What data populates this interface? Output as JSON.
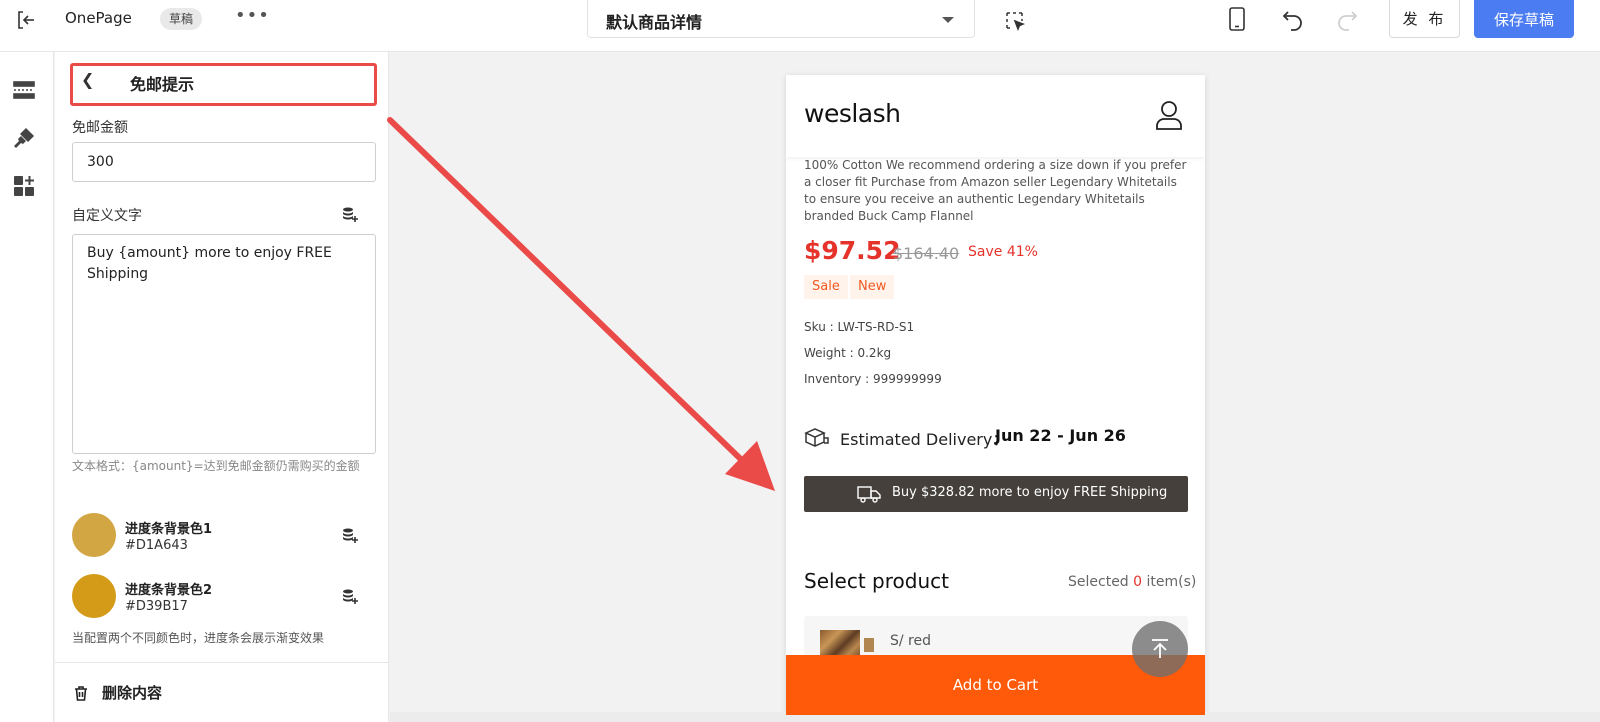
{
  "topbar": {
    "app_name": "OnePage",
    "status_badge": "草稿",
    "more": "•••",
    "template_select": "默认商品详情",
    "publish_label": "发 布",
    "save_label": "保存草稿"
  },
  "panel": {
    "back_title": "免邮提示",
    "amount_label": "免邮金额",
    "amount_value": "300",
    "text_label": "自定义文字",
    "text_value": "Buy {amount} more to enjoy FREE Shipping",
    "text_hint": "文本格式：{amount}=达到免邮金额仍需购买的金额",
    "colors": [
      {
        "title": "进度条背景色1",
        "hex": "#D1A643",
        "swatch": "#D1A643"
      },
      {
        "title": "进度条背景色2",
        "hex": "#D39B17",
        "swatch": "#D39B17"
      }
    ],
    "gradient_note": "当配置两个不同颜色时，进度条会展示渐变效果",
    "delete_label": "删除内容"
  },
  "preview": {
    "logo": "weslash",
    "description": "100% Cotton We recommend ordering a size down if you prefer a closer fit Purchase from Amazon seller Legendary Whitetails to ensure you receive an authentic Legendary Whitetails branded Buck Camp Flannel",
    "price": "$97.52",
    "old_price": "$164.40",
    "save": "Save 41%",
    "tags": [
      "Sale",
      "New"
    ],
    "sku": "Sku : LW-TS-RD-S1",
    "weight": "Weight : 0.2kg",
    "inventory": "Inventory : 999999999",
    "delivery_label": "Estimated Delivery：",
    "delivery_date": "Jun 22 - Jun 26",
    "shipping_bar": "Buy $328.82 more to enjoy FREE Shipping",
    "select_title": "Select product",
    "selected_prefix": "Selected",
    "selected_count": "0",
    "selected_suffix": "item(s)",
    "variant": "S/ red",
    "cart_label": "Add to Cart"
  },
  "colors": {
    "accent_blue": "#4b7cf2",
    "price_red": "#e5332b",
    "cart_orange": "#ff5a0a",
    "highlight_red": "#ea4a48",
    "bar_dark": "#45403c"
  },
  "icons": {
    "rail": [
      "section-icon",
      "paint-icon",
      "add-block-icon"
    ]
  }
}
